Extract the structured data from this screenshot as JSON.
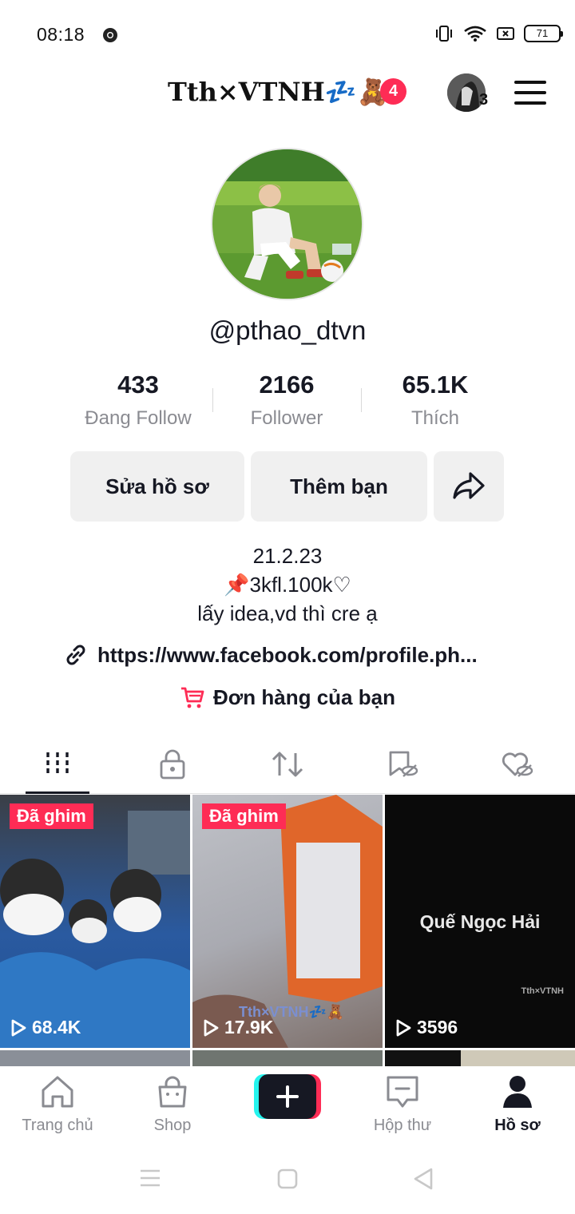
{
  "status_bar": {
    "time": "08:18",
    "battery": "71"
  },
  "header": {
    "title": "Tth×VTNH💤🧸",
    "notification_count": "4",
    "account_count": "3"
  },
  "profile": {
    "handle": "@pthao_dtvn",
    "stats": [
      {
        "value": "433",
        "label": "Đang Follow"
      },
      {
        "value": "2166",
        "label": "Follower"
      },
      {
        "value": "65.1K",
        "label": "Thích"
      }
    ],
    "buttons": {
      "edit": "Sửa hồ sơ",
      "add_friend": "Thêm bạn"
    },
    "bio": [
      "21.2.23",
      "📌3kfl.100k♡",
      "lấy idea,vd thì cre ạ"
    ],
    "link": "https://www.facebook.com/profile.ph...",
    "orders": "Đơn hàng của bạn"
  },
  "tabs": [
    "videos-tab",
    "private-tab",
    "reposts-tab",
    "favorites-tab",
    "liked-tab"
  ],
  "videos": [
    {
      "pinned": "Đã ghim",
      "views": "68.4K"
    },
    {
      "pinned": "Đã ghim",
      "views": "17.9K",
      "watermark": "Tth×VTNH💤🧸"
    },
    {
      "caption": "Quế Ngọc Hải",
      "watermark": "Tth×VTNH",
      "views": "3596"
    }
  ],
  "bottom_nav": {
    "home": "Trang chủ",
    "shop": "Shop",
    "inbox": "Hộp thư",
    "profile": "Hồ sơ"
  },
  "colors": {
    "accent": "#fe2c55",
    "cyan": "#25f4ee",
    "text": "#161823",
    "muted": "#8a8b91"
  }
}
